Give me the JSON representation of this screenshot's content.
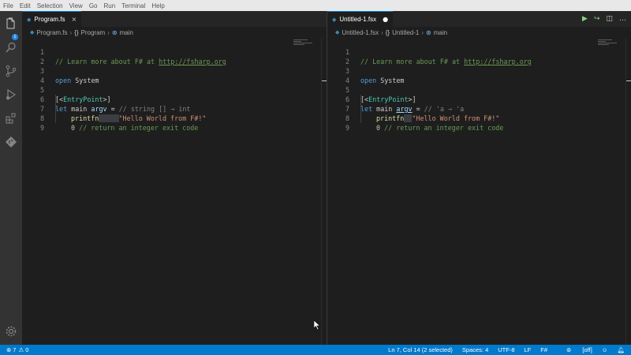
{
  "menu": [
    "File",
    "Edit",
    "Selection",
    "View",
    "Go",
    "Run",
    "Terminal",
    "Help"
  ],
  "activity": {
    "badge": "1"
  },
  "left_editor": {
    "tab_label": "Program.fs",
    "tab_close": "×",
    "breadcrumb": {
      "file": "Program.fs",
      "namespace": "Program",
      "symbol": "main"
    },
    "line_numbers": [
      "1",
      "2",
      "3",
      "4",
      "5",
      "6",
      "7",
      "8",
      "9"
    ],
    "lines": {
      "l1_comment": "// Learn more about F# at ",
      "l1_link": "http://fsharp.org",
      "l3_kw": "open",
      "l3_ident": " System",
      "l5_br1": "[<",
      "l5_attr": "EntryPoint",
      "l5_br2": ">]",
      "l6_kw": "let",
      "l6_name": " main ",
      "l6_arg": "argv",
      "l6_eq": " = ",
      "l6_hint": "// string [] → int",
      "l7_fn": "printfn",
      "l7_hint": "     ",
      "l7_str": "\"Hello World from F#!\"",
      "l8_num": "0",
      "l8_comment": " // return an integer exit code"
    }
  },
  "right_editor": {
    "tab_label": "Untitled-1.fsx",
    "tab_dirty": "●",
    "actions": {
      "run": "▶",
      "share": "↪",
      "split": "◫",
      "more": "…"
    },
    "breadcrumb": {
      "file": "Untitled-1.fsx",
      "namespace": "Untitled-1",
      "symbol": "main"
    },
    "line_numbers": [
      "1",
      "2",
      "3",
      "4",
      "5",
      "6",
      "7",
      "8",
      "9"
    ],
    "lines": {
      "l1_comment": "// Learn more about F# at ",
      "l1_link": "http://fsharp.org",
      "l3_kw": "open",
      "l3_ident": " System",
      "l5_br1": "[<",
      "l5_attr": "EntryPoint",
      "l5_br2": ">]",
      "l6_kw": "let",
      "l6_name": " main ",
      "l6_arg": "argv",
      "l6_eq": " = ",
      "l6_hint": "// 'a → 'a",
      "l7_fn": "printfn",
      "l7_hint": "  ",
      "l7_str": "\"Hello World from F#!\"",
      "l8_num": "0",
      "l8_comment": " // return an integer exit code"
    }
  },
  "status": {
    "errors": "7",
    "warnings": "0",
    "position": "Ln 7, Col 14 (2 selected)",
    "spaces": "Spaces: 4",
    "encoding": "UTF-8",
    "eol": "LF",
    "language": "F#",
    "live": "[off]"
  },
  "colors": {
    "accent": "#007acc",
    "background": "#1e1e1e",
    "activity_bar": "#333333"
  }
}
